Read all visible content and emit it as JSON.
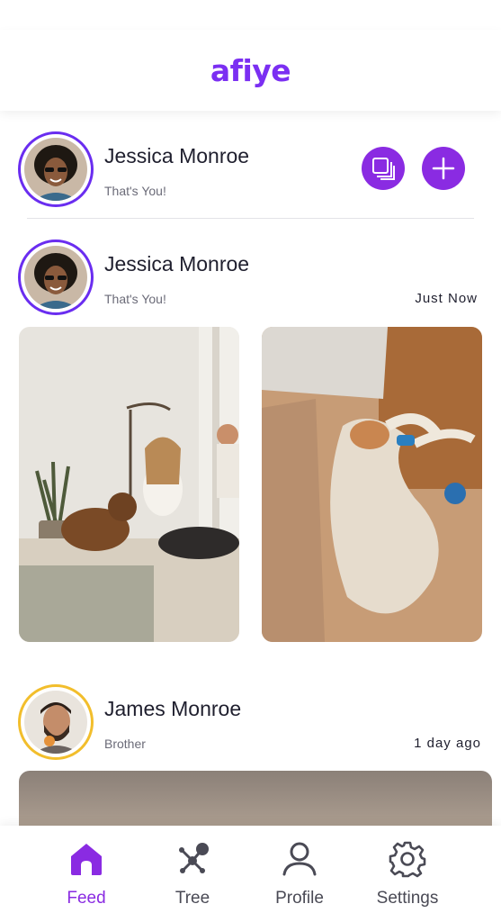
{
  "app": {
    "logo": "afiye"
  },
  "composer": {
    "name": "Jessica Monroe",
    "relation": "That's You!",
    "gallery_icon": "gallery-stack-icon",
    "add_icon": "plus-icon"
  },
  "posts": [
    {
      "author": "Jessica Monroe",
      "relation": "That's You!",
      "time": "Just Now",
      "photos": [
        "women-with-dog-on-bed-photo",
        "sleeping-dog-photo"
      ]
    },
    {
      "author": "James Monroe",
      "relation": "Brother",
      "time": "1 day ago",
      "photos": [
        "sunset-landscape-photo"
      ]
    }
  ],
  "nav": {
    "items": [
      {
        "label": "Feed",
        "icon": "home-icon",
        "active": true
      },
      {
        "label": "Tree",
        "icon": "tree-network-icon",
        "active": false
      },
      {
        "label": "Profile",
        "icon": "user-icon",
        "active": false
      },
      {
        "label": "Settings",
        "icon": "gear-icon",
        "active": false
      }
    ]
  },
  "colors": {
    "accent": "#8a2be2",
    "avatar_ring_self": "#6a2df0",
    "avatar_ring_family": "#f2be2c",
    "text": "#1f1f2e",
    "muted": "#6b6b78"
  }
}
